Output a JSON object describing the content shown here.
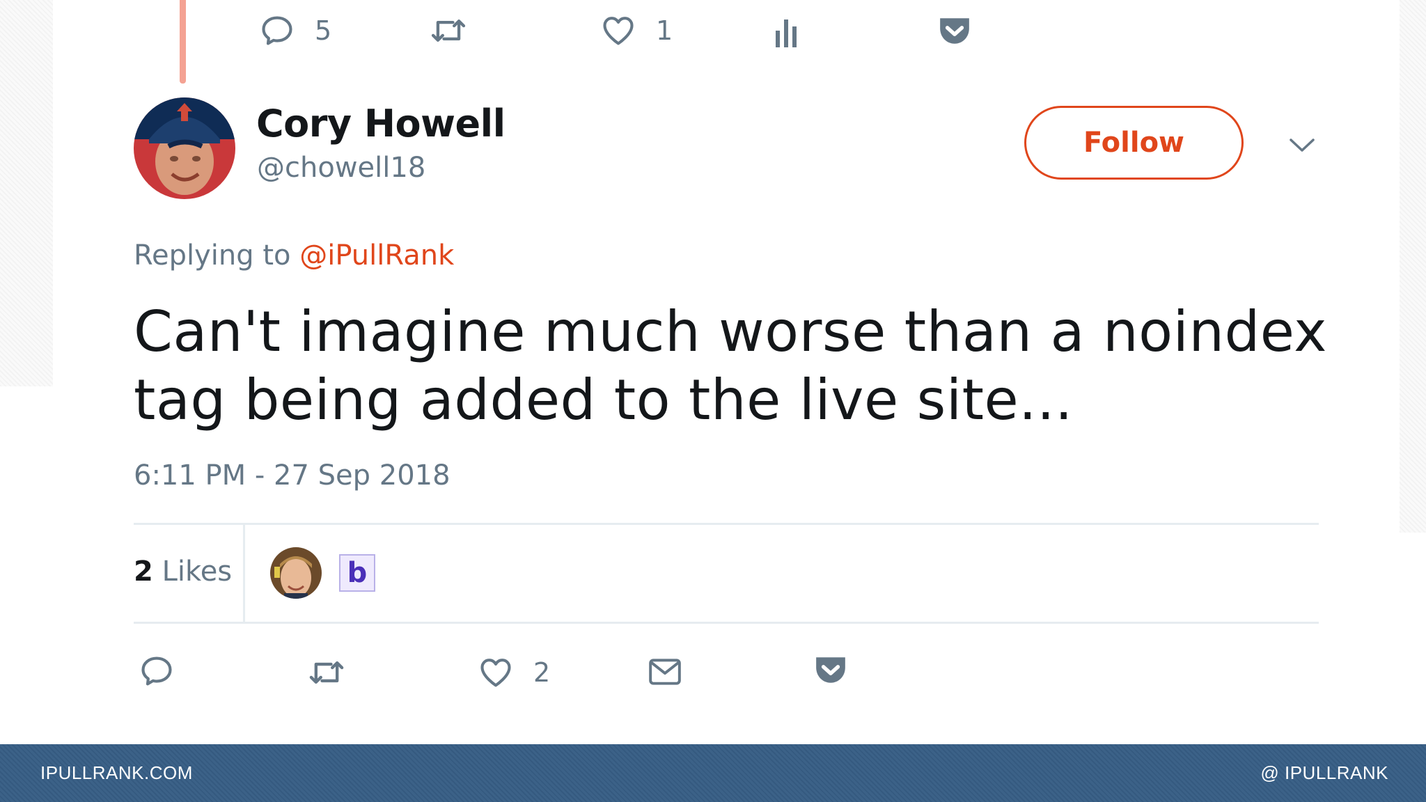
{
  "parent_tweet_actions": {
    "reply_count": "5",
    "like_count": "1"
  },
  "tweet": {
    "author_name": "Cory Howell",
    "author_handle": "@chowell18",
    "follow_label": "Follow",
    "replying_prefix": "Replying to",
    "replying_mention": "@iPullRank",
    "text": "Can't imagine much worse than a noindex tag being added to the live site...",
    "timestamp": "6:11 PM - 27 Sep 2018"
  },
  "likes": {
    "count": "2",
    "label": "Likes",
    "likers": [
      "liker-avatar-photo",
      "liker-avatar-b"
    ],
    "liker_b_letter": "b"
  },
  "tweet_actions": {
    "like_count": "2"
  },
  "footer": {
    "left": "IPULLRANK.COM",
    "right": "@ IPULLRANK"
  },
  "colors": {
    "accent": "#e0461b",
    "muted": "#657786",
    "footer_bg": "#375c82",
    "thread_line": "#f4a293"
  },
  "icons": [
    "reply-icon",
    "retweet-icon",
    "heart-icon",
    "analytics-icon",
    "pocket-icon",
    "mail-icon",
    "chevron-down-icon"
  ]
}
